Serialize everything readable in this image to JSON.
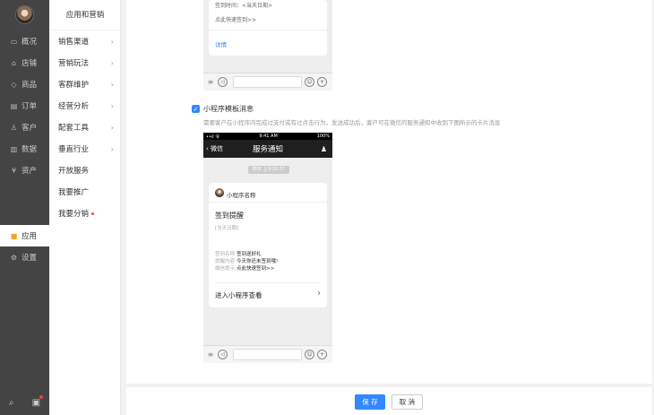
{
  "nav": {
    "items": [
      {
        "icon": "monitor-icon",
        "glyph": "▭",
        "label": "概况"
      },
      {
        "icon": "shop-icon",
        "glyph": "⌂",
        "label": "店铺"
      },
      {
        "icon": "tag-icon",
        "glyph": "◇",
        "label": "商品"
      },
      {
        "icon": "order-icon",
        "glyph": "▤",
        "label": "订单"
      },
      {
        "icon": "user-icon",
        "glyph": "♙",
        "label": "客户"
      },
      {
        "icon": "chart-icon",
        "glyph": "▥",
        "label": "数据"
      },
      {
        "icon": "asset-icon",
        "glyph": "¥",
        "label": "资产"
      },
      {
        "icon": "apps-icon",
        "glyph": "■",
        "label": "应用"
      },
      {
        "icon": "gear-icon",
        "glyph": "⚙",
        "label": "设置"
      }
    ]
  },
  "sub": {
    "title": "应用和营销",
    "items": [
      {
        "label": "销售渠道",
        "chevron": "›"
      },
      {
        "label": "营销玩法",
        "chevron": "›"
      },
      {
        "label": "客群维护",
        "chevron": "›"
      },
      {
        "label": "经营分析",
        "chevron": "›"
      },
      {
        "label": "配套工具",
        "chevron": "›"
      },
      {
        "label": "垂直行业",
        "chevron": "›"
      },
      {
        "label": "开放服务",
        "chevron": ""
      },
      {
        "label": "我要推广",
        "chevron": ""
      },
      {
        "label": "我要分销",
        "chevron": ""
      }
    ]
  },
  "top_preview": {
    "line1": "签到时间：<当天日期>",
    "line2": "点此快速签到>>",
    "detail": "详情"
  },
  "miniprogram": {
    "checkbox_label": "小程序模板消息",
    "checked": true,
    "description": "需要客户在小程序内完成过支付或有过点击行为，发送成功后，客户可在微信的服务通知中收到下图所示的卡片消息"
  },
  "phone": {
    "status_left": "••ıl 令",
    "status_time": "9:41 AM",
    "status_right": "100%",
    "back_label": "微信",
    "title": "服务通知",
    "time_badge": "昨天 上午10:37",
    "card_name": "小程序名称",
    "card_title": "签到提醒",
    "card_date": "[当天日期]",
    "fields": [
      {
        "k": "签到名称",
        "v": "签到送好礼"
      },
      {
        "k": "提醒内容",
        "v": "今天你还未签到哦!"
      },
      {
        "k": "微信提示",
        "v": "点此快速签到>>"
      }
    ],
    "enter_label": "进入小程序查看"
  },
  "footer": {
    "save": "保 存",
    "cancel": "取 消"
  }
}
